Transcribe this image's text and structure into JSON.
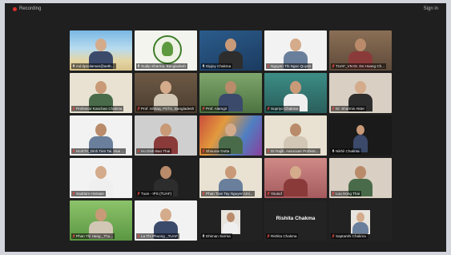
{
  "window": {
    "recording_label": "Recording",
    "sign_in_label": "Sign in"
  },
  "colors": {
    "background": "#1f1f1f",
    "active_speaker_border": "#7bcf3c",
    "muted_mic": "#e04a3f"
  },
  "participants": [
    {
      "name": "md.tipoolaman@aetb...",
      "muted": false,
      "bg": "beach",
      "active": false
    },
    {
      "name": "Sudip Sharma, Bangladesh",
      "muted": false,
      "bg": "logo",
      "active": true
    },
    {
      "name": "Dipjoy Chakma",
      "muted": false,
      "bg": "blue",
      "active": false
    },
    {
      "name": "Nguyen Thi Ngoc Quyen",
      "muted": true,
      "bg": "white",
      "active": false
    },
    {
      "name": "TUAF_VN Dr. Do Hoang Ch...",
      "muted": true,
      "bg": "office",
      "active": false
    },
    {
      "name": "Professor Kanchan Chakma",
      "muted": true,
      "bg": "cream",
      "active": false
    },
    {
      "name": "Prof. Ishtiaq, PSTU, Bangladesh",
      "muted": true,
      "bg": "shelf",
      "active": false
    },
    {
      "name": "Prof. Alamgir",
      "muted": true,
      "bg": "outdoor",
      "active": false
    },
    {
      "name": "Supriyo Chakma",
      "muted": true,
      "bg": "teal",
      "active": false
    },
    {
      "name": "Dr. Sharmin Akter",
      "muted": true,
      "bg": "wall",
      "active": false
    },
    {
      "name": "HUSTA_Dinh Tien Tai, Hue ...",
      "muted": true,
      "bg": "white",
      "active": false
    },
    {
      "name": "Ho Dinh Bao Thai",
      "muted": true,
      "bg": "grey",
      "active": false
    },
    {
      "name": "Shourav Dutta",
      "muted": true,
      "bg": "colorful",
      "active": false
    },
    {
      "name": "Dr Rajib, Associate Profess...",
      "muted": true,
      "bg": "cream",
      "active": false
    },
    {
      "name": "Nikhil Chakma",
      "muted": false,
      "bg": "black-white",
      "active": false
    },
    {
      "name": "Saddam Hossain",
      "muted": true,
      "bg": "white",
      "active": false
    },
    {
      "name": "Tuan - IPS (TUAF)",
      "muted": true,
      "bg": "dark",
      "active": false
    },
    {
      "name": "Phan Tran Tay Nguyen Uni...",
      "muted": true,
      "bg": "cream",
      "active": false
    },
    {
      "name": "Yousuf",
      "muted": true,
      "bg": "pink",
      "active": false
    },
    {
      "name": "Luu Hong Thai",
      "muted": true,
      "bg": "wall",
      "active": false
    },
    {
      "name": "Phan Thi Hang _Thu...",
      "muted": true,
      "bg": "green",
      "active": false
    },
    {
      "name": "La Thi Phuong _TUAF",
      "muted": true,
      "bg": "white",
      "active": false
    },
    {
      "name": "Dhiman Sarma",
      "muted": false,
      "bg": "photo-dark",
      "active": false
    },
    {
      "name": "Rishita Chakma",
      "muted": true,
      "bg": "name-only",
      "big_label": "Rishita Chakma",
      "active": false
    },
    {
      "name": "Saptarshi Chakma",
      "muted": true,
      "bg": "small-photo",
      "active": false
    }
  ]
}
